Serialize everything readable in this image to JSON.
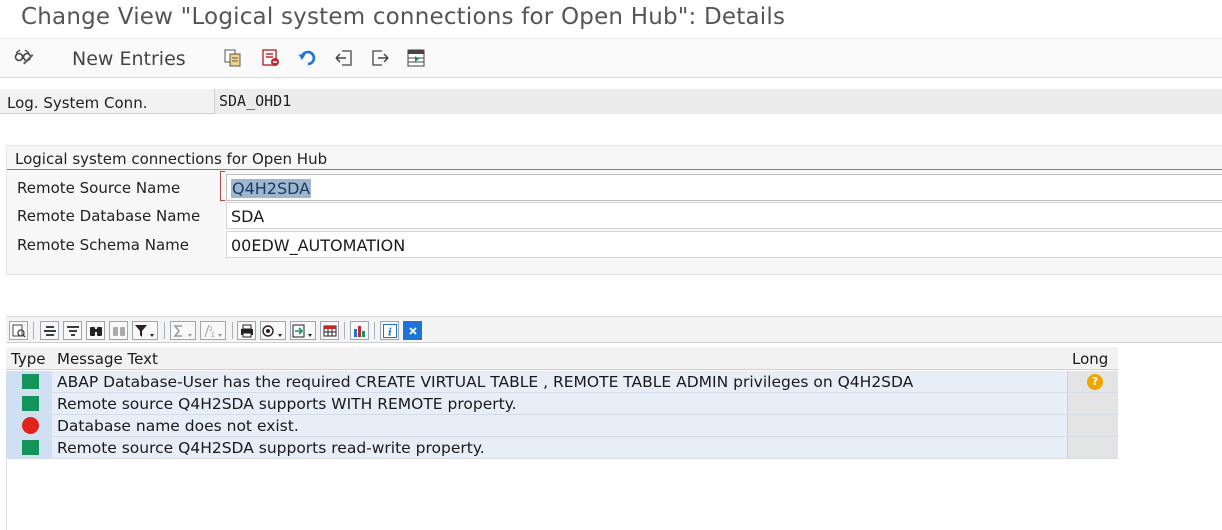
{
  "window": {
    "title": "Change View \"Logical system connections for Open Hub\": Details"
  },
  "toolbar": {
    "new_entries": "New Entries",
    "icons": [
      "glasses-display-change-icon",
      "copy-as-icon",
      "delete-icon",
      "undo-icon",
      "previous-entry-icon",
      "next-entry-icon",
      "select-all-icon"
    ]
  },
  "header": {
    "label": "Log. System Conn.",
    "value": "SDA_OHD1"
  },
  "group": {
    "title": "Logical system connections for Open Hub",
    "fields": [
      {
        "label": "Remote Source Name",
        "value": "Q4H2SDA"
      },
      {
        "label": "Remote Database Name",
        "value": "SDA"
      },
      {
        "label": "Remote Schema Name",
        "value": "00EDW_AUTOMATION"
      }
    ]
  },
  "messages": {
    "columns": {
      "type": "Type",
      "text": "Message Text",
      "long": "Long"
    },
    "rows": [
      {
        "type": "success",
        "text": "ABAP Database-User has the required CREATE VIRTUAL TABLE , REMOTE TABLE ADMIN  privileges on Q4H2SDA",
        "long": "help-icon"
      },
      {
        "type": "success",
        "text": "Remote source Q4H2SDA supports WITH REMOTE property.",
        "long": ""
      },
      {
        "type": "error",
        "text": "Database name  does not exist.",
        "long": ""
      },
      {
        "type": "success",
        "text": "Remote source Q4H2SDA supports read-write property.",
        "long": ""
      }
    ]
  },
  "colors": {
    "success": "#14935a",
    "error": "#e0241c",
    "selection": "#9fb6cf",
    "group_line": "#4a8ad8"
  }
}
